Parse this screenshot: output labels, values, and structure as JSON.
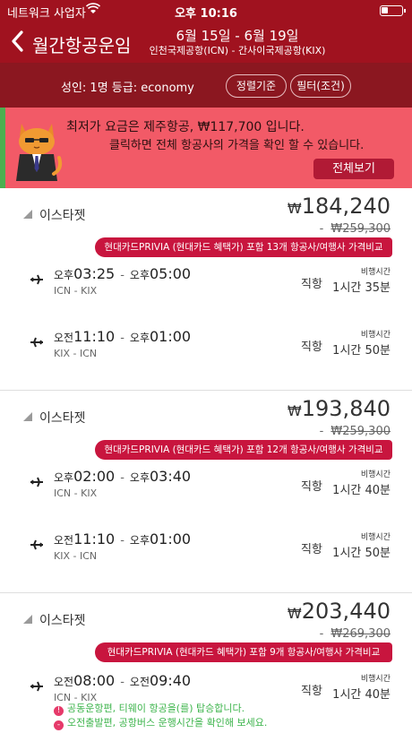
{
  "status_bar": {
    "carrier": "네트워크 사업자",
    "time": "오후 10:16",
    "battery_level": 0.3
  },
  "nav": {
    "title": "월간항공운임",
    "dates": "6월 15일 - 6월 19일",
    "route": "인천국제공항(ICN) - 간사이국제공항(KIX)"
  },
  "filter_bar": {
    "info": "성인: 1명 등급: economy",
    "sort_label": "정렬기준",
    "filter_label": "필터(조건)"
  },
  "promo": {
    "line1": "최저가 요금은 제주항공, ₩117,700 입니다.",
    "line2": "클릭하면 전체 항공사의 가격을 확인 할 수 있습니다.",
    "button": "전체보기"
  },
  "flights": [
    {
      "airline": "이스타젯",
      "currency": "₩",
      "price": "184,240",
      "old_dash": "-",
      "old_price": "₩259,300",
      "banner": "현대카드PRIVIA (현대카드 혜택가) 포함 13개 항공사/여행사 가격비교",
      "segments": [
        {
          "dep_ampm": "오후",
          "dep_time": "03:25",
          "sep": "-",
          "arr_ampm": "오후",
          "arr_time": "05:00",
          "codes": "ICN - KIX",
          "type": "직항",
          "dur_label": "비행시간",
          "duration": "1시간 35분"
        },
        {
          "dep_ampm": "오전",
          "dep_time": "11:10",
          "sep": "-",
          "arr_ampm": "오후",
          "arr_time": "01:00",
          "codes": "KIX - ICN",
          "type": "직항",
          "dur_label": "비행시간",
          "duration": "1시간 50분"
        }
      ]
    },
    {
      "airline": "이스타젯",
      "currency": "₩",
      "price": "193,840",
      "old_dash": "-",
      "old_price": "₩259,300",
      "banner": "현대카드PRIVIA (현대카드 혜택가) 포함 12개 항공사/여행사 가격비교",
      "segments": [
        {
          "dep_ampm": "오후",
          "dep_time": "02:00",
          "sep": "-",
          "arr_ampm": "오후",
          "arr_time": "03:40",
          "codes": "ICN - KIX",
          "type": "직항",
          "dur_label": "비행시간",
          "duration": "1시간 40분"
        },
        {
          "dep_ampm": "오전",
          "dep_time": "11:10",
          "sep": "-",
          "arr_ampm": "오후",
          "arr_time": "01:00",
          "codes": "KIX - ICN",
          "type": "직항",
          "dur_label": "비행시간",
          "duration": "1시간 50분"
        }
      ]
    },
    {
      "airline": "이스타젯",
      "currency": "₩",
      "price": "203,440",
      "old_dash": "-",
      "old_price": "₩269,300",
      "banner": "현대카드PRIVIA (현대카드 혜택가) 포함 9개 항공사/여행사 가격비교",
      "segments": [
        {
          "dep_ampm": "오전",
          "dep_time": "08:00",
          "sep": "-",
          "arr_ampm": "오전",
          "arr_time": "09:40",
          "codes": "ICN - KIX",
          "type": "직항",
          "dur_label": "비행시간",
          "duration": "1시간 40분"
        }
      ],
      "notes": [
        {
          "icon": "!",
          "text": "공동운항편, 티웨이 항공을(를) 탑승합니다."
        },
        {
          "icon": "-",
          "text": "오전출발편, 공항버스 운행시간을 확인해 보세요."
        }
      ]
    }
  ],
  "colors": {
    "header": "#a0121f",
    "promo_bg": "#f25a67",
    "banner": "#c8153e",
    "note_green": "#3cb44b"
  }
}
